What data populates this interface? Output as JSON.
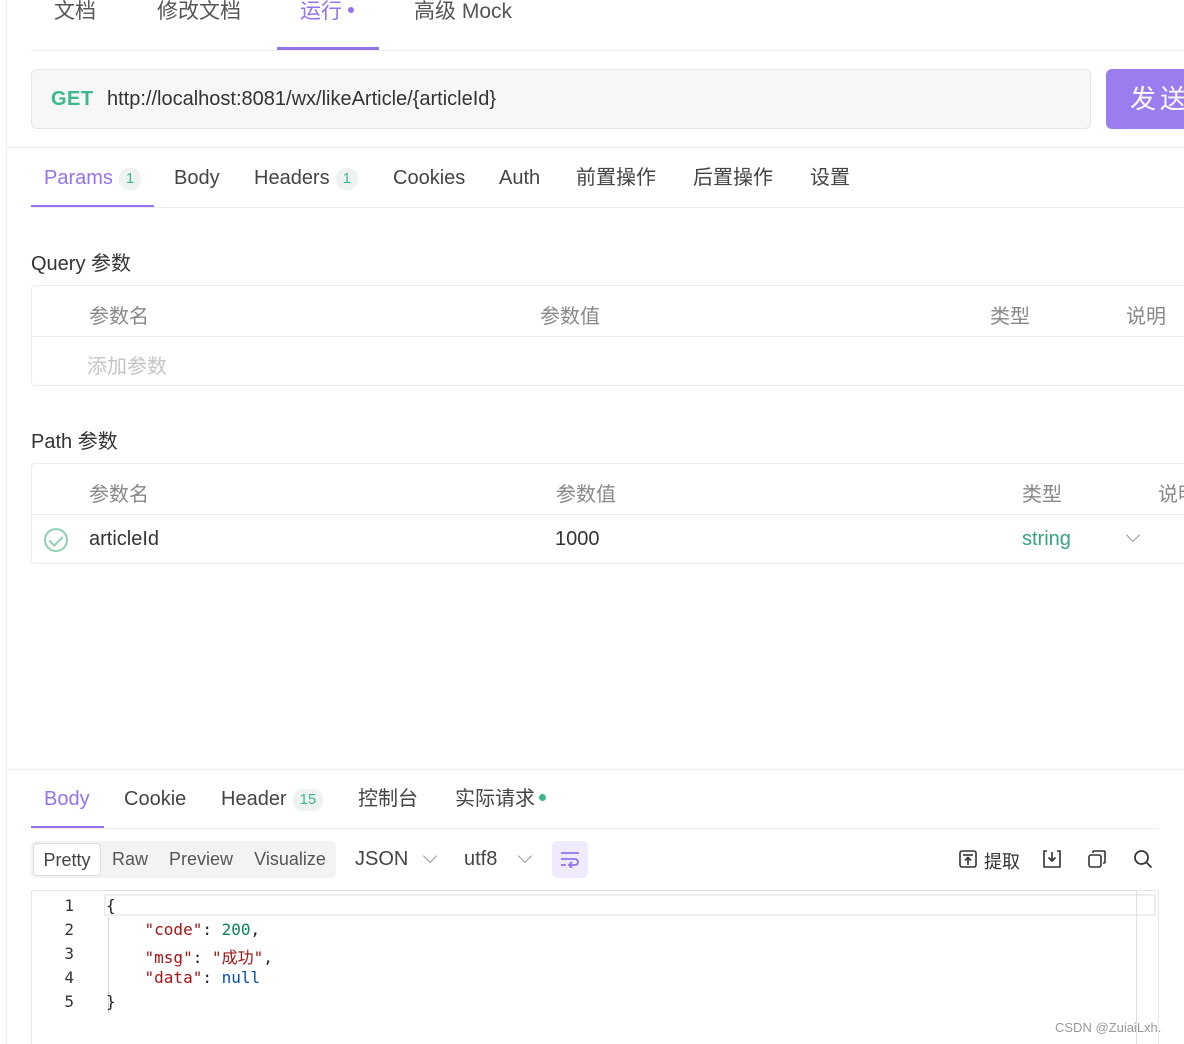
{
  "top_tabs": [
    {
      "label": "文档"
    },
    {
      "label": "修改文档"
    },
    {
      "label": "运行"
    },
    {
      "label": "高级 Mock"
    }
  ],
  "request": {
    "method": "GET",
    "url": "http://localhost:8081/wx/likeArticle/{articleId}",
    "send_label": "发送"
  },
  "request_tabs": [
    {
      "label": "Params",
      "badge": "1"
    },
    {
      "label": "Body"
    },
    {
      "label": "Headers",
      "badge": "1"
    },
    {
      "label": "Cookies"
    },
    {
      "label": "Auth"
    },
    {
      "label": "前置操作"
    },
    {
      "label": "后置操作"
    },
    {
      "label": "设置"
    }
  ],
  "query": {
    "title": "Query 参数",
    "headers": [
      "参数名",
      "参数值",
      "类型",
      "说明"
    ],
    "placeholder": "添加参数"
  },
  "path": {
    "title": "Path 参数",
    "headers": [
      "参数名",
      "参数值",
      "类型",
      "说明"
    ],
    "rows": [
      {
        "name": "articleId",
        "value": "1000",
        "type": "string"
      }
    ]
  },
  "response_tabs": [
    {
      "label": "Body"
    },
    {
      "label": "Cookie"
    },
    {
      "label": "Header",
      "badge": "15"
    },
    {
      "label": "控制台"
    },
    {
      "label": "实际请求"
    }
  ],
  "view_modes": [
    "Pretty",
    "Raw",
    "Preview",
    "Visualize"
  ],
  "format_select": "JSON",
  "encoding_select": "utf8",
  "tools": {
    "extract_label": "提取"
  },
  "code": {
    "line_numbers": [
      "1",
      "2",
      "3",
      "4",
      "5"
    ],
    "open_brace": "{",
    "close_brace": "}",
    "fields": [
      {
        "key": "\"code\"",
        "value": "200"
      },
      {
        "key": "\"msg\"",
        "value": "\"成功\""
      },
      {
        "key": "\"data\"",
        "value": "null"
      }
    ]
  },
  "watermark": "CSDN @ZuiaiLxh.",
  "colors": {
    "accent": "#9373ee",
    "method": "#3db88e",
    "type": "#3aa183"
  }
}
